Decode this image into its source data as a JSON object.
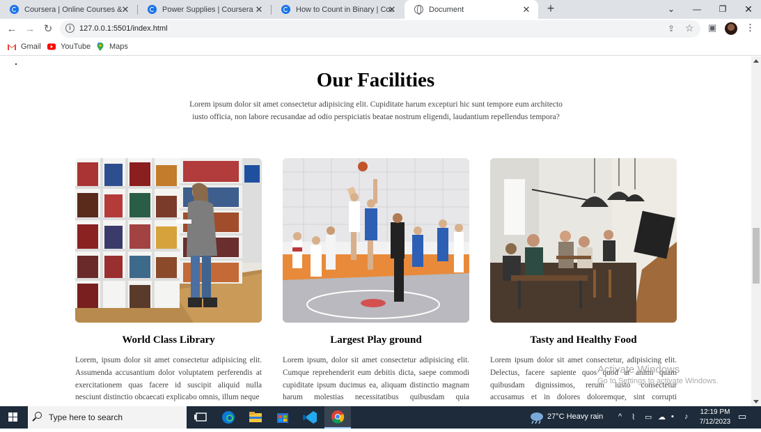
{
  "browser": {
    "tabs": [
      {
        "title": "Coursera | Online Courses & Cre",
        "icon": "coursera-icon",
        "active": false
      },
      {
        "title": "Power Supplies | Coursera",
        "icon": "coursera-icon",
        "active": false
      },
      {
        "title": "How to Count in Binary | Courser",
        "icon": "coursera-icon",
        "active": false
      },
      {
        "title": "Document",
        "icon": "globe-icon",
        "active": true
      }
    ],
    "new_tab_label": "+",
    "url": "127.0.0.1:5501/index.html",
    "bookmarks": [
      {
        "label": "Gmail",
        "icon": "gmail-icon"
      },
      {
        "label": "YouTube",
        "icon": "youtube-icon"
      },
      {
        "label": "Maps",
        "icon": "maps-icon"
      }
    ]
  },
  "page": {
    "heading": "Our Facilities",
    "intro": "Lorem ipsum dolor sit amet consectetur adipisicing elit. Cupiditate harum excepturi hic sunt tempore eum architecto iusto officia, non labore recusandae ad odio perspiciatis beatae nostrum eligendi, laudantium repellendus tempora?",
    "cards": [
      {
        "title": "World Class Library",
        "image": "library-photo",
        "text": "Lorem, ipsum dolor sit amet consectetur adipisicing elit. Assumenda accusantium dolor voluptatem perferendis at exercitationem quas facere id suscipit aliquid nulla nesciunt distinctio obcaecati explicabo omnis, illum neque"
      },
      {
        "title": "Largest Play ground",
        "image": "basketball-photo",
        "text": "Lorem ipsum, dolor sit amet consectetur adipisicing elit. Cumque reprehenderit eum debitis dicta, saepe commodi cupiditate ipsum ducimus ea, aliquam distinctio magnam harum molestias necessitatibus quibusdam quia perspiciatis"
      },
      {
        "title": "Tasty and Healthy Food",
        "image": "cafe-photo",
        "text": "Lorem ipsum dolor sit amet consectetur, adipisicing elit. Delectus, facere sapiente quos quod at animi quam quibusdam dignissimos, rerum iusto consectetur accusamus et in dolores doloremque, sint corrupti cupiditate labore."
      }
    ]
  },
  "watermark": {
    "line1": "Activate Windows",
    "line2": "Go to Settings to activate Windows."
  },
  "taskbar": {
    "search_placeholder": "Type here to search",
    "weather": "27°C  Heavy rain",
    "time": "12:19 PM",
    "date": "7/12/2023"
  }
}
